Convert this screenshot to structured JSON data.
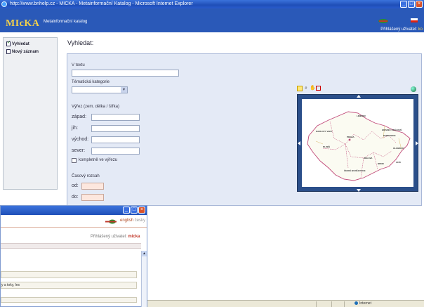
{
  "window": {
    "title": "http://www.bnhelp.cz - MICKA - Metainformační Katalog - Microsoft Internet Explorer",
    "controls": {
      "minimize": "_",
      "maximize": "□",
      "close": "×"
    }
  },
  "header": {
    "logo": "MIcKA",
    "subtitle": "Metainformační katalog",
    "user_label": "Přihlášený uživatel:",
    "user_value": "ko"
  },
  "sidebar": {
    "items": [
      {
        "label": "Vyhledat",
        "icon": "search-check-icon"
      },
      {
        "label": "Nový záznam",
        "icon": "new-document-icon"
      }
    ]
  },
  "main": {
    "title": "Vyhledat:",
    "form": {
      "text_label": "V textu",
      "text_value": "",
      "category_label": "Tématická kategorie",
      "category_value": "",
      "extent_label": "Výřez (zem. délka / šířka)",
      "west_label": "západ:",
      "south_label": "jih:",
      "east_label": "východ:",
      "north_label": "sever:",
      "complete_label": "kompletně ve výřezu",
      "time_label": "Časový rozsah",
      "from_label": "od:",
      "to_label": "do:"
    },
    "map": {
      "tools": [
        "zoom-rect-icon",
        "zoom-in-icon",
        "pan-hand-icon",
        "stop-icon"
      ],
      "overview_icon": "globe-icon",
      "labels": [
        "LIBEREC",
        "KARLOVY VARY",
        "PRAHA",
        "HRADEC KRÁLOVÉ",
        "PARDUBICE",
        "OLOMOUC",
        "PLZEŇ",
        "JIHLAVA",
        "BRNO",
        "ZLÍN",
        "ČESKÉ BUDĚJOVICE"
      ]
    }
  },
  "popup": {
    "title": "",
    "controls": {
      "minimize": "_",
      "maximize": "□",
      "close": "×"
    },
    "lang_active": "english",
    "lang_alt": "česky",
    "user_label": "Přihlášený uživatel:",
    "user_value": "micka",
    "snippet": "y a toky, les"
  },
  "status": {
    "zone": "Internet"
  },
  "colors": {
    "titlebar": "#1f4fb8",
    "header": "#2a59b8",
    "logo": "#f2d04a",
    "panel": "#e4eaf6",
    "map_frame": "#2b4f8a",
    "popup_user": "#c2392b"
  }
}
